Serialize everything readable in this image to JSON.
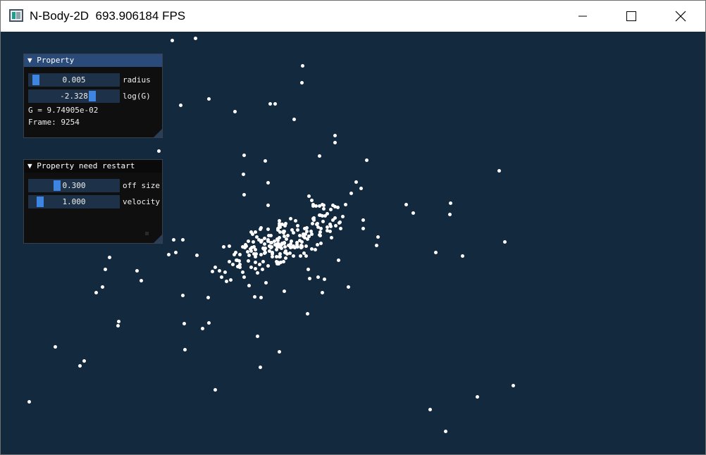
{
  "window": {
    "title": "N-Body-2D  693.906184 FPS",
    "controls": {
      "minimize": "minimize-icon",
      "maximize": "maximize-icon",
      "close": "close-icon"
    }
  },
  "colors": {
    "background": "#13293d",
    "particle": "#ffffff",
    "slider_grab": "#3d85e0",
    "header_active": "#2a4a7a"
  },
  "panel_property": {
    "title": "▼ Property",
    "sliders": [
      {
        "value_text": "0.005",
        "label": "radius",
        "fill": 0.05
      },
      {
        "value_text": "-2.328",
        "label": "log(G)",
        "fill": 0.72
      }
    ],
    "g_text": "G = 9.74905e-02",
    "frame_text": "Frame: 9254"
  },
  "panel_restart": {
    "title": "▼ Property need restart",
    "sliders": [
      {
        "value_text": "0.300",
        "label": "off size",
        "fill": 0.3
      },
      {
        "value_text": "1.000",
        "label": "velocity",
        "fill": 0.1
      }
    ]
  }
}
